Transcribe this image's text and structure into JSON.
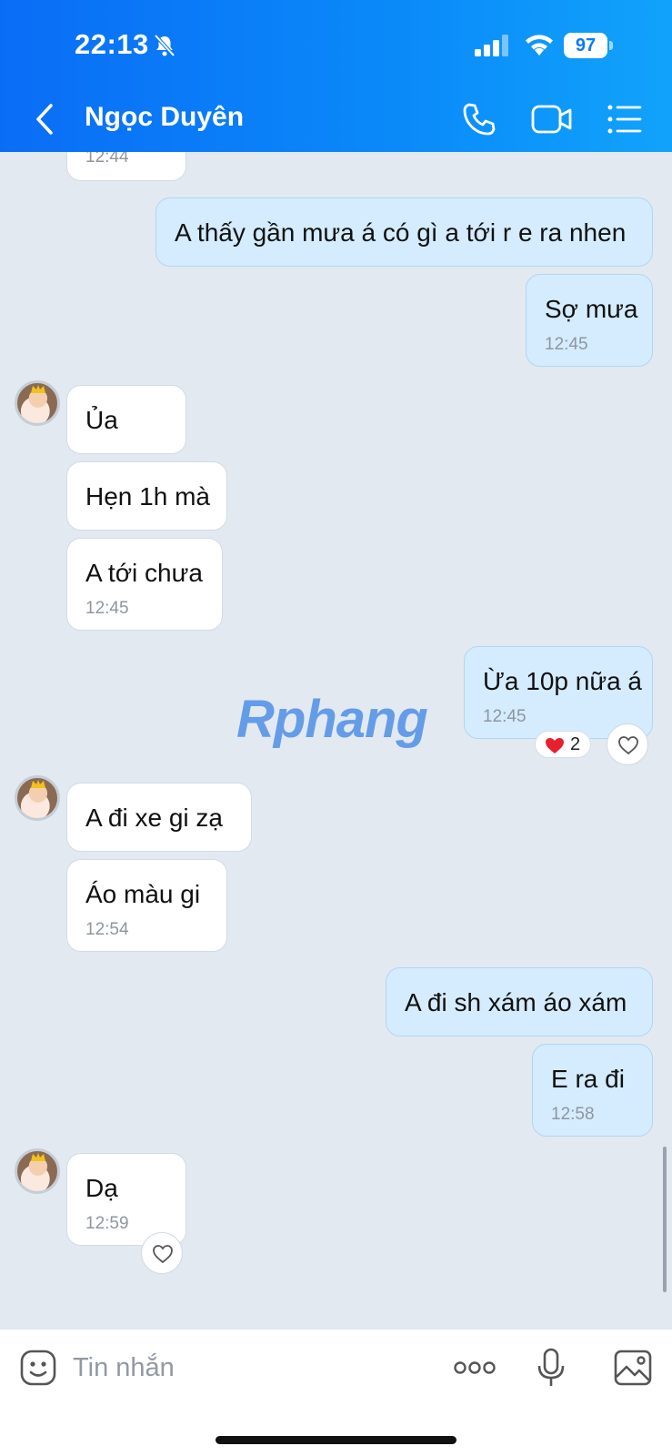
{
  "status_bar": {
    "time": "22:13",
    "battery": "97"
  },
  "header": {
    "contact_name": "Ngọc Duyên"
  },
  "messages": [
    {
      "dir": "in",
      "text": "",
      "time": "12:44"
    },
    {
      "dir": "out",
      "text": "A thấy gần mưa á có gì a tới r e ra nhen",
      "time": ""
    },
    {
      "dir": "out",
      "text": "Sợ mưa",
      "time": "12:45"
    },
    {
      "dir": "in",
      "text": "Ủa",
      "time": ""
    },
    {
      "dir": "in",
      "text": "Hẹn 1h mà",
      "time": ""
    },
    {
      "dir": "in",
      "text": "A tới chưa",
      "time": "12:45"
    },
    {
      "dir": "out",
      "text": "Ừa 10p nữa á",
      "time": "12:45",
      "reaction": {
        "icon": "heart-icon",
        "count": "2"
      }
    },
    {
      "dir": "in",
      "text": "A đi xe gi zạ",
      "time": ""
    },
    {
      "dir": "in",
      "text": "Áo màu gi",
      "time": "12:54"
    },
    {
      "dir": "out",
      "text": "A đi sh xám áo xám",
      "time": ""
    },
    {
      "dir": "out",
      "text": "E ra đi",
      "time": "12:58"
    },
    {
      "dir": "in",
      "text": "Dạ",
      "time": "12:59"
    }
  ],
  "watermark": "Rphang",
  "input_bar": {
    "placeholder": "Tin nhắn"
  },
  "colors": {
    "header": "#0a7af8",
    "bubble_out": "#d4ecfd",
    "bubble_in": "#ffffff",
    "background": "#e2e9f1"
  }
}
